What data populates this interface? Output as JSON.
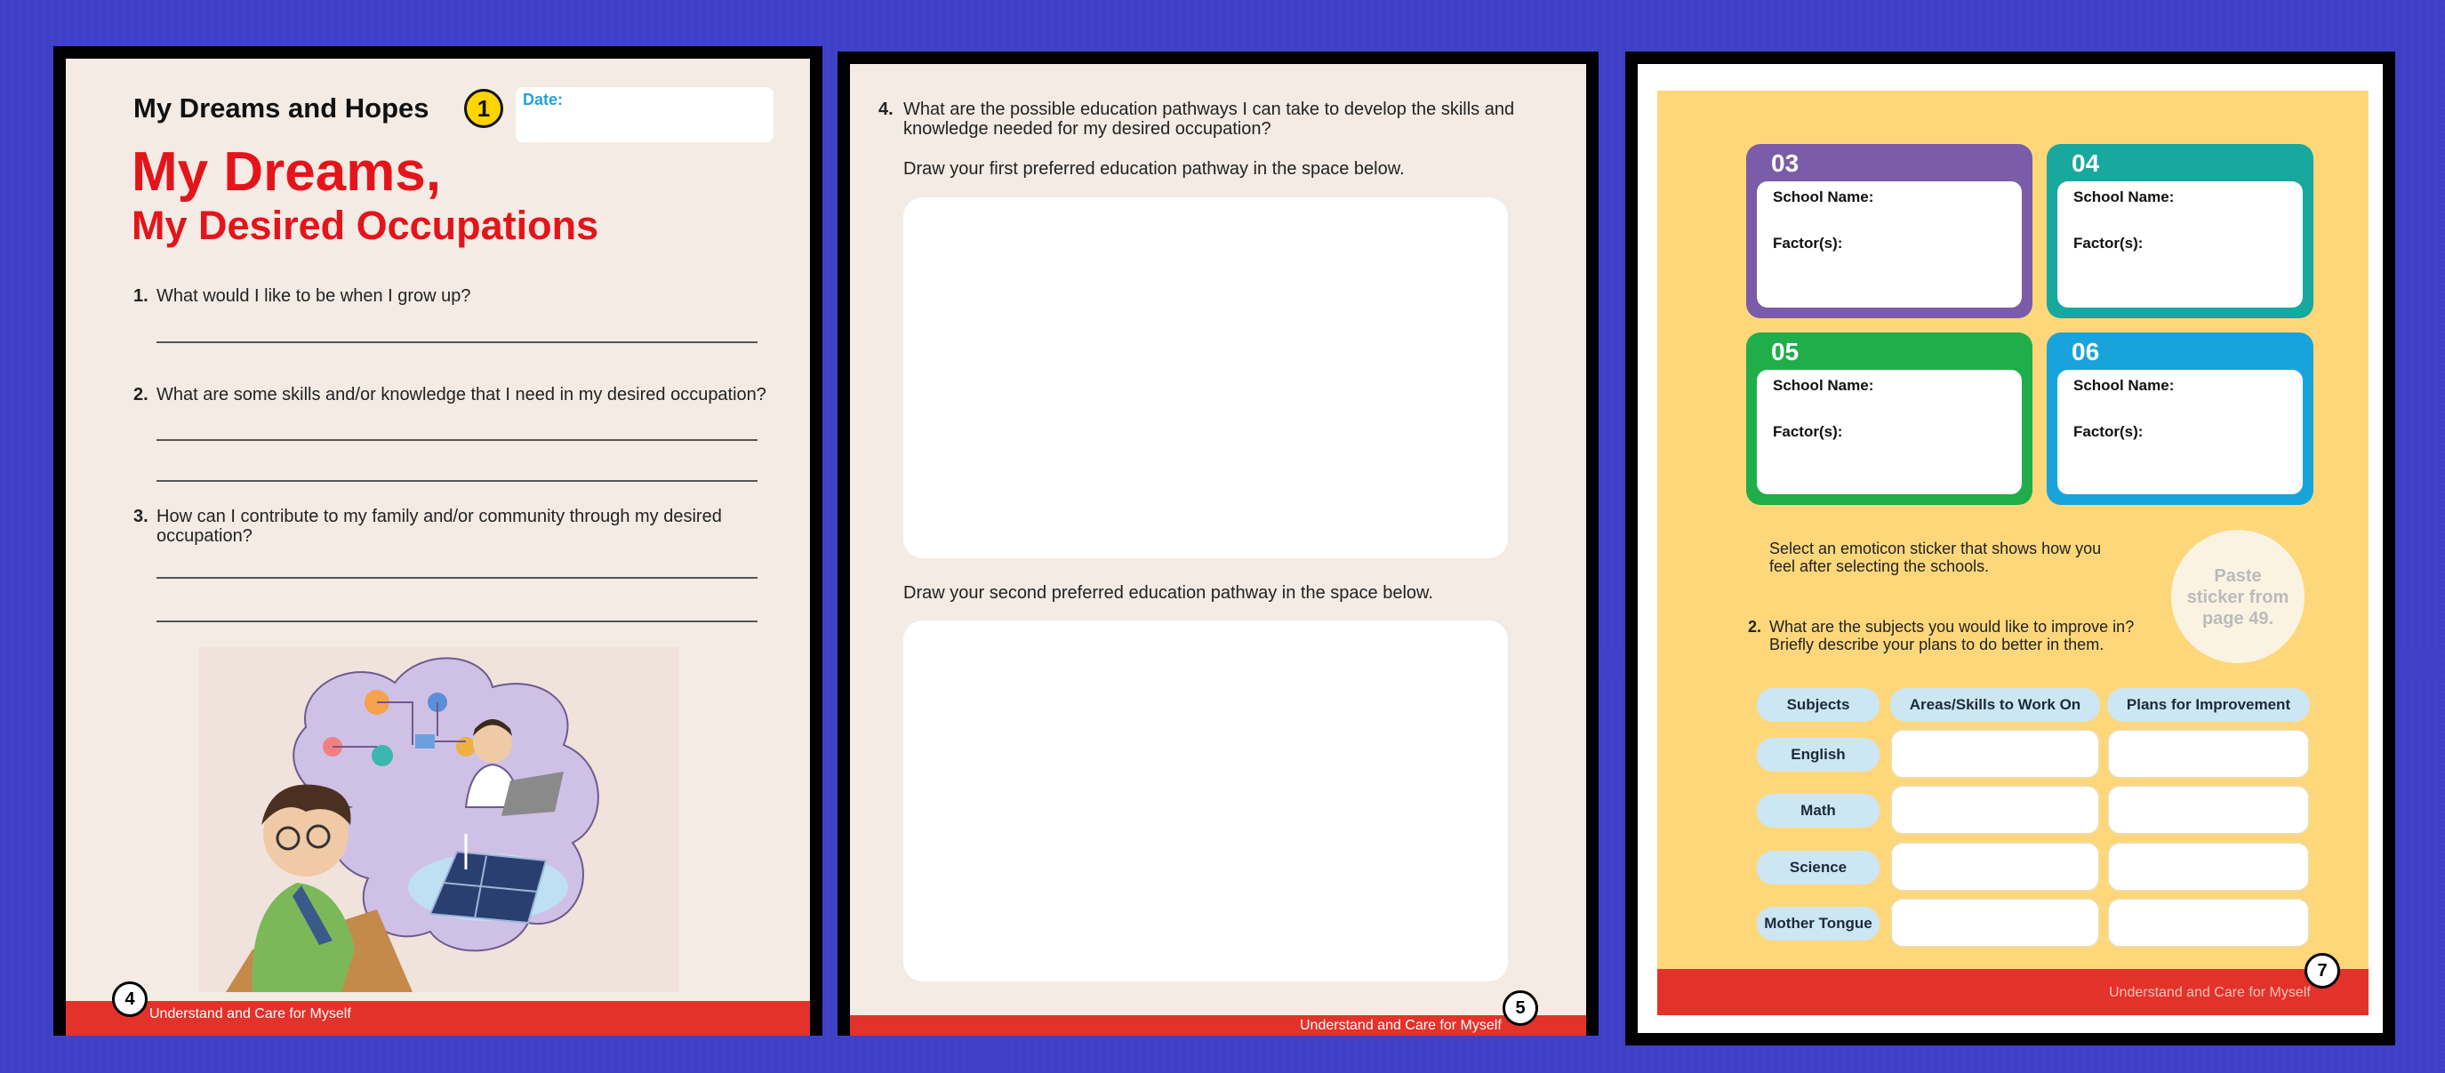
{
  "page4": {
    "header_title": "My Dreams and Hopes",
    "badge_number": "1",
    "date_label": "Date:",
    "title_line1": "My Dreams,",
    "title_line2": "My Desired Occupations",
    "questions": [
      {
        "num": "1.",
        "text": "What would I like to be when I grow up?"
      },
      {
        "num": "2.",
        "text": "What are some skills and/or knowledge that I need in my desired occupation?"
      },
      {
        "num": "3.",
        "text_line1": "How can I contribute to my family and/or community through my desired",
        "text_line2": "occupation?"
      }
    ],
    "illustration": "boy-dreaming-of-doctor-and-solar-panels",
    "footer": "Understand and Care for Myself",
    "page_number": "4"
  },
  "page5": {
    "question_num": "4.",
    "question_line1": "What are the possible education pathways I can take to develop the skills and",
    "question_line2": "knowledge needed for my desired occupation?",
    "instruction1": "Draw your first preferred education pathway in the space below.",
    "instruction2": "Draw your second preferred education pathway in the space below.",
    "footer": "Understand and Care for Myself",
    "page_number": "5"
  },
  "page7": {
    "cards": [
      {
        "num": "03",
        "color": "#7a5ca8",
        "school_label": "School Name:",
        "factor_label": "Factor(s):"
      },
      {
        "num": "04",
        "color": "#17a89e",
        "school_label": "School Name:",
        "factor_label": "Factor(s):"
      },
      {
        "num": "05",
        "color": "#1fae4a",
        "school_label": "School Name:",
        "factor_label": "Factor(s):"
      },
      {
        "num": "06",
        "color": "#19a3dc",
        "school_label": "School Name:",
        "factor_label": "Factor(s):"
      }
    ],
    "sticker_line1": "Select an emoticon sticker that shows how you",
    "sticker_line2": "feel after selecting the schools.",
    "paste_line1": "Paste",
    "paste_line2": "sticker from",
    "paste_line3": "page 49.",
    "q2_num": "2.",
    "q2_line1": "What are the subjects you would like to improve in?",
    "q2_line2": "Briefly describe your plans to do better in them.",
    "table_headers": [
      "Subjects",
      "Areas/Skills to Work On",
      "Plans for Improvement"
    ],
    "subjects": [
      "English",
      "Math",
      "Science",
      "Mother Tongue"
    ],
    "footer": "Understand and Care for Myself",
    "page_number": "7"
  }
}
